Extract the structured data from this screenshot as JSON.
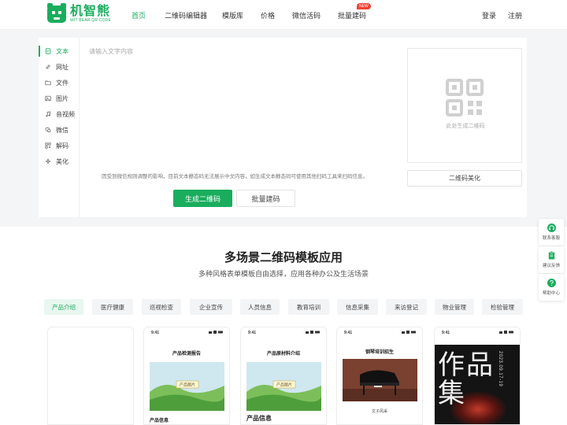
{
  "brand": {
    "name": "机智熊",
    "sub": "WIT BEAR QR CODE",
    "color": "#1aad5e"
  },
  "nav": {
    "items": [
      "首页",
      "二维码编辑器",
      "模版库",
      "价格",
      "微信活码",
      "批量建码"
    ],
    "new_badge": "NEW",
    "login": "登录",
    "register": "注册"
  },
  "sidebar": {
    "items": [
      {
        "label": "文本",
        "icon": "text-doc-icon"
      },
      {
        "label": "网址",
        "icon": "link-icon"
      },
      {
        "label": "文件",
        "icon": "folder-icon"
      },
      {
        "label": "图片",
        "icon": "image-icon"
      },
      {
        "label": "音视频",
        "icon": "music-note-icon"
      },
      {
        "label": "微信",
        "icon": "wechat-icon"
      },
      {
        "label": "解码",
        "icon": "scan-icon"
      },
      {
        "label": "美化",
        "icon": "sparkle-icon"
      }
    ]
  },
  "editor": {
    "placeholder": "请输入文字内容",
    "notice": "因受到微信规则调整的影响，目前文本静态码无法展示中文内容，如生成文本静态码可使用其他扫码工具来扫码信息。",
    "generate": "生成二维码",
    "batch": "批量建码"
  },
  "preview": {
    "hint": "此处生成二维码",
    "beautify": "二维码美化"
  },
  "float": {
    "service": "联系客服",
    "feedback": "建议反馈",
    "help": "帮助中心"
  },
  "templates": {
    "title": "多场景二维码模板应用",
    "subtitle": "多种风格表单模板自由选择，应用各种办公及生活场景",
    "categories": [
      "产品介绍",
      "医疗健康",
      "巡视检查",
      "企业宣传",
      "人员信息",
      "教育培训",
      "信息采集",
      "来访登记",
      "物业管理",
      "检验管理"
    ],
    "cards": [
      {
        "time": "",
        "title": "",
        "caption": ""
      },
      {
        "time": "9:41",
        "title": "产品检测报告",
        "caption": "产品信息",
        "img_label": "产品图片"
      },
      {
        "time": "9:41",
        "title": "产品原材料介绍",
        "caption": "产品信息",
        "img_label": "产品图片"
      },
      {
        "time": "9:41",
        "title": "钢琴培训招生",
        "caption": "",
        "piano_name": "文子风采"
      },
      {
        "time": "9:41",
        "poster_big": "作品集",
        "poster_date": "2023.09.17-19"
      }
    ]
  }
}
